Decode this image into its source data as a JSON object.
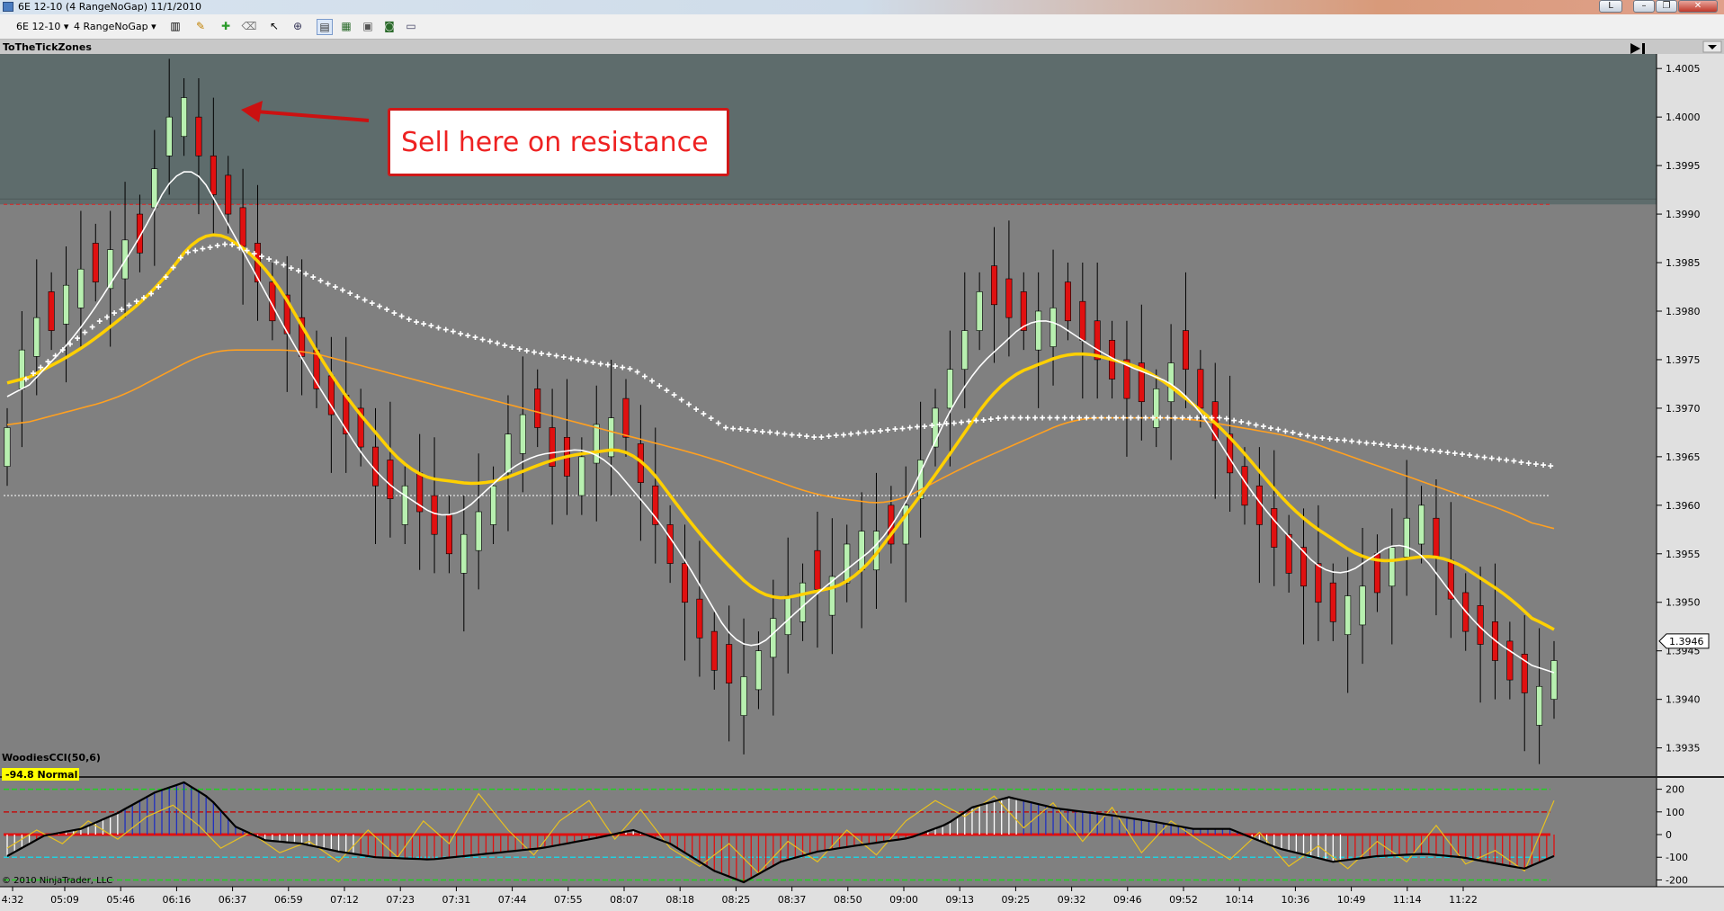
{
  "window": {
    "title": "6E 12-10 (4 RangeNoGap)  11/1/2010",
    "buttons": {
      "label_l": "L",
      "minimize": "–",
      "restore": "❐",
      "close": "✕"
    }
  },
  "toolbar": {
    "instrument": "6E 12-10",
    "period": "4 RangeNoGap"
  },
  "colors": {
    "background": "#808080",
    "zone": "#5e6c6c",
    "bull": "#b8f0b0",
    "bear": "#e01010",
    "ema_fast": "#ffffff",
    "ema_mid": "#ffd000",
    "ema_slow": "#ffa020",
    "dots": "#ffffff",
    "callout_text": "#ee2222",
    "cci_bull": "#2030c0",
    "cci_bear": "#e01010"
  },
  "chart": {
    "indicator_name": "ToTheTickZones",
    "annotation": "Sell here on resistance",
    "last_price": "1.3946",
    "copyright": "© 2010 NinjaTrader, LLC"
  },
  "chart_data": [
    {
      "type": "candlestick",
      "title": "",
      "y_ticks": [
        "1.4005",
        "1.4000",
        "1.3995",
        "1.3990",
        "1.3985",
        "1.3980",
        "1.3975",
        "1.3970",
        "1.3965",
        "1.3960",
        "1.3955",
        "1.3950",
        "1.3945",
        "1.3940",
        "1.3935"
      ],
      "x_ticks": [
        "4:32",
        "05:09",
        "05:46",
        "06:16",
        "06:37",
        "06:59",
        "07:12",
        "07:23",
        "07:31",
        "07:44",
        "07:55",
        "08:07",
        "08:18",
        "08:25",
        "08:37",
        "08:50",
        "09:00",
        "09:13",
        "09:25",
        "09:32",
        "09:46",
        "09:52",
        "10:14",
        "10:36",
        "10:49",
        "11:14",
        "11:22"
      ],
      "ylim": [
        1.3932,
        1.40065
      ],
      "resistance_zone": [
        1.3991,
        1.40065
      ],
      "resistance_line": 1.3991,
      "pivot_line": 1.3961,
      "last_price": 1.3946,
      "close_path": [
        [
          0,
          1.3968
        ],
        [
          6,
          1.398
        ],
        [
          12,
          1.3978
        ],
        [
          18,
          1.3985
        ],
        [
          24,
          1.3983
        ],
        [
          30,
          1.3988
        ],
        [
          36,
          1.3986
        ],
        [
          42,
          1.3999
        ],
        [
          48,
          1.4002
        ],
        [
          54,
          1.3993
        ],
        [
          60,
          1.399
        ],
        [
          66,
          1.3985
        ],
        [
          72,
          1.3979
        ],
        [
          78,
          1.3977
        ],
        [
          84,
          1.3972
        ],
        [
          90,
          1.3968
        ],
        [
          96,
          1.3966
        ],
        [
          102,
          1.396
        ],
        [
          108,
          1.3962
        ],
        [
          114,
          1.3958
        ],
        [
          120,
          1.3955
        ],
        [
          126,
          1.3958
        ],
        [
          132,
          1.3962
        ],
        [
          138,
          1.397
        ],
        [
          144,
          1.3968
        ],
        [
          150,
          1.3962
        ],
        [
          156,
          1.3965
        ],
        [
          162,
          1.397
        ],
        [
          168,
          1.3967
        ],
        [
          174,
          1.396
        ],
        [
          180,
          1.3954
        ],
        [
          186,
          1.3948
        ],
        [
          192,
          1.3943
        ],
        [
          198,
          1.3941
        ],
        [
          204,
          1.3945
        ],
        [
          210,
          1.395
        ],
        [
          216,
          1.3952
        ],
        [
          222,
          1.3951
        ],
        [
          228,
          1.3956
        ],
        [
          234,
          1.3958
        ],
        [
          240,
          1.3956
        ],
        [
          246,
          1.3962
        ],
        [
          252,
          1.397
        ],
        [
          258,
          1.3976
        ],
        [
          264,
          1.3982
        ],
        [
          270,
          1.398
        ],
        [
          276,
          1.3978
        ],
        [
          282,
          1.3981
        ],
        [
          288,
          1.3979
        ],
        [
          294,
          1.3976
        ],
        [
          300,
          1.3973
        ],
        [
          306,
          1.397
        ],
        [
          312,
          1.3972
        ],
        [
          318,
          1.3976
        ],
        [
          324,
          1.397
        ],
        [
          330,
          1.3965
        ],
        [
          336,
          1.396
        ],
        [
          342,
          1.3957
        ],
        [
          348,
          1.3953
        ],
        [
          354,
          1.3951
        ],
        [
          360,
          1.3948
        ],
        [
          366,
          1.3952
        ],
        [
          372,
          1.3951
        ],
        [
          378,
          1.3958
        ],
        [
          384,
          1.396
        ],
        [
          390,
          1.3952
        ],
        [
          396,
          1.3947
        ],
        [
          402,
          1.3945
        ],
        [
          408,
          1.3942
        ],
        [
          414,
          1.394
        ],
        [
          420,
          1.3944
        ]
      ],
      "ema_fast": [
        [
          0,
          1.397
        ],
        [
          20,
          1.3978
        ],
        [
          40,
          1.399
        ],
        [
          48,
          1.3997
        ],
        [
          60,
          1.3989
        ],
        [
          80,
          1.3975
        ],
        [
          100,
          1.3963
        ],
        [
          120,
          1.3958
        ],
        [
          140,
          1.3965
        ],
        [
          160,
          1.3966
        ],
        [
          180,
          1.3957
        ],
        [
          200,
          1.3944
        ],
        [
          220,
          1.3951
        ],
        [
          240,
          1.3957
        ],
        [
          260,
          1.3973
        ],
        [
          280,
          1.398
        ],
        [
          300,
          1.3975
        ],
        [
          320,
          1.3972
        ],
        [
          340,
          1.396
        ],
        [
          360,
          1.3952
        ],
        [
          380,
          1.3957
        ],
        [
          400,
          1.3947
        ],
        [
          420,
          1.3942
        ]
      ],
      "ema_mid": [
        [
          0,
          1.3972
        ],
        [
          20,
          1.3976
        ],
        [
          40,
          1.3982
        ],
        [
          54,
          1.3989
        ],
        [
          70,
          1.3985
        ],
        [
          90,
          1.3972
        ],
        [
          110,
          1.3963
        ],
        [
          130,
          1.3962
        ],
        [
          150,
          1.3965
        ],
        [
          170,
          1.3966
        ],
        [
          190,
          1.3956
        ],
        [
          206,
          1.395
        ],
        [
          230,
          1.3952
        ],
        [
          250,
          1.3962
        ],
        [
          270,
          1.3973
        ],
        [
          290,
          1.3976
        ],
        [
          310,
          1.3974
        ],
        [
          330,
          1.3968
        ],
        [
          350,
          1.3959
        ],
        [
          370,
          1.3954
        ],
        [
          390,
          1.3955
        ],
        [
          410,
          1.395
        ],
        [
          420,
          1.3946
        ]
      ],
      "ema_slow": [
        [
          0,
          1.3968
        ],
        [
          30,
          1.3971
        ],
        [
          55,
          1.3976
        ],
        [
          80,
          1.3976
        ],
        [
          110,
          1.3973
        ],
        [
          150,
          1.3969
        ],
        [
          190,
          1.3965
        ],
        [
          220,
          1.3961
        ],
        [
          240,
          1.396
        ],
        [
          260,
          1.3964
        ],
        [
          290,
          1.3969
        ],
        [
          320,
          1.3969
        ],
        [
          350,
          1.3967
        ],
        [
          380,
          1.3963
        ],
        [
          410,
          1.3959
        ],
        [
          420,
          1.3957
        ]
      ],
      "dots": [
        [
          5,
          1.3973
        ],
        [
          25,
          1.3979
        ],
        [
          40,
          1.3982
        ],
        [
          48,
          1.3986
        ],
        [
          60,
          1.3987
        ],
        [
          80,
          1.3984
        ],
        [
          110,
          1.3979
        ],
        [
          140,
          1.3976
        ],
        [
          170,
          1.3974
        ],
        [
          195,
          1.3968
        ],
        [
          220,
          1.3967
        ],
        [
          245,
          1.3968
        ],
        [
          270,
          1.3969
        ],
        [
          290,
          1.3969
        ],
        [
          310,
          1.3969
        ],
        [
          330,
          1.3969
        ],
        [
          355,
          1.3967
        ],
        [
          380,
          1.3966
        ],
        [
          420,
          1.3964
        ]
      ]
    },
    {
      "type": "bar",
      "title": "WoodiesCCI(50,6)",
      "status_label": "-94.8 Normal",
      "y_ticks": [
        "200",
        "100",
        "0",
        "-100",
        "-200"
      ],
      "ylim": [
        -230,
        250
      ],
      "levels": [
        200,
        100,
        0,
        -100,
        -200
      ],
      "cci_path": [
        [
          0,
          -95
        ],
        [
          10,
          -5
        ],
        [
          20,
          25
        ],
        [
          30,
          95
        ],
        [
          40,
          185
        ],
        [
          48,
          230
        ],
        [
          55,
          160
        ],
        [
          62,
          35
        ],
        [
          70,
          -25
        ],
        [
          80,
          -40
        ],
        [
          90,
          -75
        ],
        [
          100,
          -100
        ],
        [
          115,
          -110
        ],
        [
          130,
          -85
        ],
        [
          145,
          -60
        ],
        [
          160,
          -15
        ],
        [
          170,
          20
        ],
        [
          180,
          -40
        ],
        [
          192,
          -160
        ],
        [
          200,
          -210
        ],
        [
          210,
          -120
        ],
        [
          220,
          -75
        ],
        [
          230,
          -50
        ],
        [
          245,
          -15
        ],
        [
          255,
          45
        ],
        [
          262,
          120
        ],
        [
          272,
          165
        ],
        [
          285,
          115
        ],
        [
          300,
          85
        ],
        [
          312,
          55
        ],
        [
          322,
          25
        ],
        [
          332,
          25
        ],
        [
          345,
          -60
        ],
        [
          360,
          -120
        ],
        [
          372,
          -95
        ],
        [
          385,
          -85
        ],
        [
          395,
          -100
        ],
        [
          405,
          -130
        ],
        [
          412,
          -150
        ],
        [
          420,
          -94.8
        ]
      ],
      "trigger_path": [
        [
          0,
          -60
        ],
        [
          8,
          20
        ],
        [
          15,
          -40
        ],
        [
          22,
          60
        ],
        [
          30,
          -20
        ],
        [
          38,
          80
        ],
        [
          45,
          130
        ],
        [
          52,
          40
        ],
        [
          58,
          -60
        ],
        [
          66,
          10
        ],
        [
          74,
          -80
        ],
        [
          82,
          -30
        ],
        [
          90,
          -120
        ],
        [
          98,
          20
        ],
        [
          106,
          -100
        ],
        [
          113,
          60
        ],
        [
          120,
          -40
        ],
        [
          128,
          180
        ],
        [
          136,
          20
        ],
        [
          143,
          -90
        ],
        [
          150,
          60
        ],
        [
          158,
          150
        ],
        [
          165,
          -20
        ],
        [
          172,
          110
        ],
        [
          180,
          -60
        ],
        [
          188,
          -140
        ],
        [
          196,
          -40
        ],
        [
          204,
          -170
        ],
        [
          212,
          -30
        ],
        [
          220,
          -120
        ],
        [
          228,
          20
        ],
        [
          236,
          -90
        ],
        [
          244,
          60
        ],
        [
          252,
          150
        ],
        [
          260,
          80
        ],
        [
          268,
          170
        ],
        [
          276,
          30
        ],
        [
          284,
          140
        ],
        [
          292,
          -30
        ],
        [
          300,
          120
        ],
        [
          308,
          -80
        ],
        [
          316,
          60
        ],
        [
          324,
          -30
        ],
        [
          332,
          -110
        ],
        [
          340,
          10
        ],
        [
          348,
          -140
        ],
        [
          356,
          -50
        ],
        [
          364,
          -150
        ],
        [
          372,
          -30
        ],
        [
          380,
          -120
        ],
        [
          388,
          40
        ],
        [
          396,
          -130
        ],
        [
          404,
          -70
        ],
        [
          412,
          -160
        ],
        [
          420,
          150
        ]
      ]
    }
  ]
}
